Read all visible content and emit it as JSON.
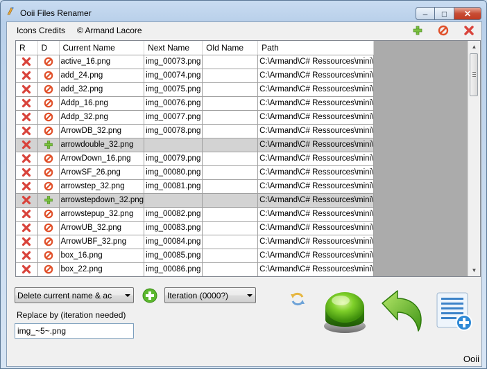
{
  "window": {
    "title": "Ooii Files Renamer",
    "minimize_glyph": "–",
    "maximize_glyph": "□",
    "close_glyph": "✕"
  },
  "menu": {
    "icons_credits": "Icons Credits",
    "author": "© Armand Lacore",
    "icons": [
      "add-icon",
      "forbidden-icon",
      "delete-icon"
    ]
  },
  "grid": {
    "columns": [
      "R",
      "D",
      "Current Name",
      "Next Name",
      "Old Name",
      "Path"
    ],
    "rows": [
      {
        "d": "forbidden",
        "current": "active_16.png",
        "next": "img_00073.png",
        "old": "",
        "path": "C:\\Armand\\C# Ressources\\mini\\",
        "gray": false
      },
      {
        "d": "forbidden",
        "current": "add_24.png",
        "next": "img_00074.png",
        "old": "",
        "path": "C:\\Armand\\C# Ressources\\mini\\",
        "gray": false
      },
      {
        "d": "forbidden",
        "current": "add_32.png",
        "next": "img_00075.png",
        "old": "",
        "path": "C:\\Armand\\C# Ressources\\mini\\",
        "gray": false
      },
      {
        "d": "forbidden",
        "current": "Addp_16.png",
        "next": "img_00076.png",
        "old": "",
        "path": "C:\\Armand\\C# Ressources\\mini\\",
        "gray": false
      },
      {
        "d": "forbidden",
        "current": "Addp_32.png",
        "next": "img_00077.png",
        "old": "",
        "path": "C:\\Armand\\C# Ressources\\mini\\",
        "gray": false
      },
      {
        "d": "forbidden",
        "current": "ArrowDB_32.png",
        "next": "img_00078.png",
        "old": "",
        "path": "C:\\Armand\\C# Ressources\\mini\\",
        "gray": false
      },
      {
        "d": "plus",
        "current": "arrowdouble_32.png",
        "next": "",
        "old": "",
        "path": "C:\\Armand\\C# Ressources\\mini\\",
        "gray": true
      },
      {
        "d": "forbidden",
        "current": "ArrowDown_16.png",
        "next": "img_00079.png",
        "old": "",
        "path": "C:\\Armand\\C# Ressources\\mini\\",
        "gray": false
      },
      {
        "d": "forbidden",
        "current": "ArrowSF_26.png",
        "next": "img_00080.png",
        "old": "",
        "path": "C:\\Armand\\C# Ressources\\mini\\",
        "gray": false
      },
      {
        "d": "forbidden",
        "current": "arrowstep_32.png",
        "next": "img_00081.png",
        "old": "",
        "path": "C:\\Armand\\C# Ressources\\mini\\",
        "gray": false
      },
      {
        "d": "plus",
        "current": "arrowstepdown_32.png",
        "next": "",
        "old": "",
        "path": "C:\\Armand\\C# Ressources\\mini\\",
        "gray": true
      },
      {
        "d": "forbidden",
        "current": "arrowstepup_32.png",
        "next": "img_00082.png",
        "old": "",
        "path": "C:\\Armand\\C# Ressources\\mini\\",
        "gray": false
      },
      {
        "d": "forbidden",
        "current": "ArrowUB_32.png",
        "next": "img_00083.png",
        "old": "",
        "path": "C:\\Armand\\C# Ressources\\mini\\",
        "gray": false
      },
      {
        "d": "forbidden",
        "current": "ArrowUBF_32.png",
        "next": "img_00084.png",
        "old": "",
        "path": "C:\\Armand\\C# Ressources\\mini\\",
        "gray": false
      },
      {
        "d": "forbidden",
        "current": "box_16.png",
        "next": "img_00085.png",
        "old": "",
        "path": "C:\\Armand\\C# Ressources\\mini\\",
        "gray": false
      },
      {
        "d": "forbidden",
        "current": "box_22.png",
        "next": "img_00086.png",
        "old": "",
        "path": "C:\\Armand\\C# Ressources\\mini\\",
        "gray": false
      }
    ]
  },
  "controls": {
    "mode_select": "Delete current name & ac",
    "iteration_select": "Iteration (0000?)",
    "replace_label": "Replace by (iteration needed)",
    "replace_value": "img_~5~.png",
    "footer": "Ooii"
  },
  "colors": {
    "selected_row": "#d3d3d3",
    "delete_red": "#d9433b",
    "plus_green": "#7cc142",
    "forbidden_orange": "#e0502a"
  }
}
